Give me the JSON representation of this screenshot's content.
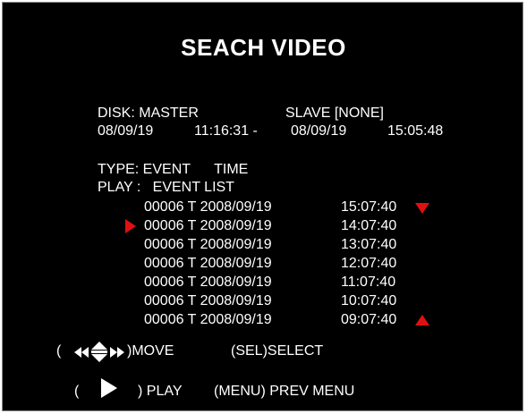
{
  "title": "SEACH VIDEO",
  "disk": {
    "label": "DISK: MASTER",
    "slave": "SLAVE [NONE]",
    "start_date": "08/09/19",
    "start_time": "11:16:31 -",
    "end_date": "08/09/19",
    "end_time": "15:05:48"
  },
  "type_line": "TYPE: EVENT      TIME",
  "play_line": "PLAY :   EVENT LIST",
  "events": [
    {
      "entry": "00006 T 2008/09/19",
      "time": "15:07:40"
    },
    {
      "entry": "00006 T 2008/09/19",
      "time": "14:07:40"
    },
    {
      "entry": "00006 T 2008/09/19",
      "time": "13:07:40"
    },
    {
      "entry": "00006 T 2008/09/19",
      "time": "12:07:40"
    },
    {
      "entry": "00006 T 2008/09/19",
      "time": "11:07:40"
    },
    {
      "entry": "00006 T 2008/09/19",
      "time": "10:07:40"
    },
    {
      "entry": "00006 T 2008/09/19",
      "time": "09:07:40"
    }
  ],
  "selected_index": 1,
  "help": {
    "move_open": "(",
    "move_label": ")MOVE",
    "select_label": "(SEL)SELECT",
    "play_open": "(",
    "play_label": ") PLAY",
    "menu_label": "(MENU) PREV MENU"
  },
  "icons": [
    "rewind-icon",
    "up-down-icon",
    "fast-forward-icon",
    "play-icon",
    "scroll-up-icon",
    "scroll-down-icon",
    "selection-cursor-icon"
  ],
  "colors": {
    "background": "#000000",
    "text": "#ffffff",
    "accent": "#e01010"
  }
}
